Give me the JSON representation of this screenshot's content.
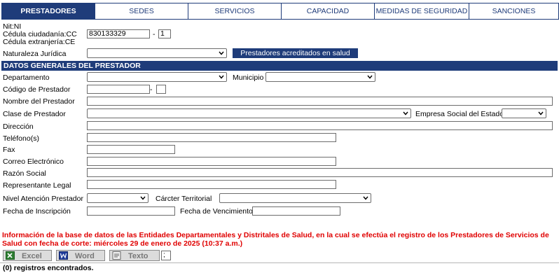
{
  "tabs": [
    {
      "label": "PRESTADORES",
      "active": true
    },
    {
      "label": "SEDES"
    },
    {
      "label": "SERVICIOS"
    },
    {
      "label": "CAPACIDAD"
    },
    {
      "label": "MEDIDAS DE SEGURIDAD"
    },
    {
      "label": "SANCIONES"
    }
  ],
  "id_block": {
    "nit_label": "Nit:NI",
    "cc_label": "Cédula ciudadanía:CC",
    "ce_label": "Cédula extranjería:CE",
    "id_value": "830133329",
    "dv_sep": "-",
    "dv_value": "1"
  },
  "naturaleza": {
    "label": "Naturaleza Jurídica",
    "value": ""
  },
  "acreditados_button": "Prestadores acreditados en salud",
  "section_title": "DATOS GENERALES DEL PRESTADOR",
  "fields": {
    "departamento": "Departamento",
    "municipio": "Municipio",
    "codigo": "Código de Prestador",
    "codigo_sep": "-",
    "nombre": "Nombre del Prestador",
    "clase": "Clase de Prestador",
    "empresa_social": "Empresa Social del Estado",
    "direccion": "Dirección",
    "telefonos": "Teléfono(s)",
    "fax": "Fax",
    "correo": "Correo Electrónico",
    "razon_social": "Razón Social",
    "representante": "Representante Legal",
    "nivel": "Nivel Atención Prestador",
    "caracter": "Cárcter Territorial",
    "fecha_inscripcion": "Fecha de Inscripción",
    "fecha_vencimiento": "Fecha de Vencimiento"
  },
  "info_text": "Información de la base de datos de las Entidades Departamentales y Distritales de Salud, en la cual se efectúa el registro de los Prestadores de Servicios de Salud con fecha de corte: miércoles 29 de enero de 2025 (10:37 a.m.)",
  "export": {
    "excel": "Excel",
    "word": "Word",
    "texto": "Texto",
    "delimiter": ";"
  },
  "records_text": "(0) registros encontrados.",
  "colors": {
    "brand": "#1f3c7a",
    "alert": "#e00000"
  }
}
